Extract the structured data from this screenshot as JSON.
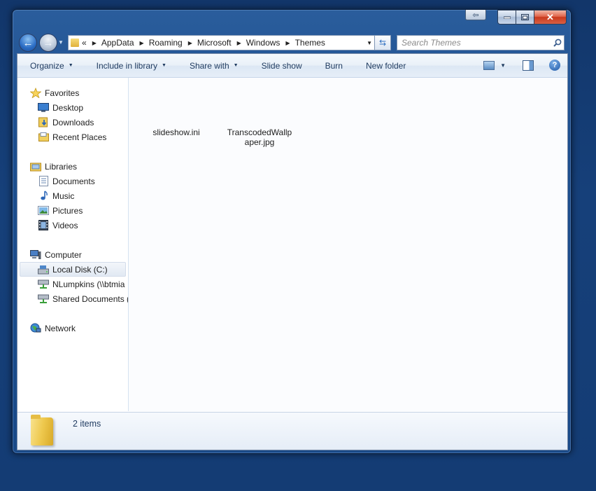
{
  "window": {
    "caption": {
      "minimize": "▁",
      "maximize": "▢",
      "close": "✕",
      "back_tab": "⇦"
    }
  },
  "nav": {
    "back_glyph": "←",
    "forward_glyph": "→",
    "address": {
      "overflow": "«",
      "crumbs": [
        "AppData",
        "Roaming",
        "Microsoft",
        "Windows",
        "Themes"
      ]
    },
    "search": {
      "placeholder": "Search Themes"
    }
  },
  "toolbar": {
    "organize": "Organize",
    "include_in_library": "Include in library",
    "share_with": "Share with",
    "slide_show": "Slide show",
    "burn": "Burn",
    "new_folder": "New folder",
    "help": "?"
  },
  "sidebar": {
    "favorites": {
      "label": "Favorites",
      "items": [
        "Desktop",
        "Downloads",
        "Recent Places"
      ]
    },
    "libraries": {
      "label": "Libraries",
      "items": [
        "Documents",
        "Music",
        "Pictures",
        "Videos"
      ]
    },
    "computer": {
      "label": "Computer",
      "items": [
        "Local Disk (C:)",
        "NLumpkins (\\\\btmia",
        "Shared Documents ("
      ]
    },
    "network": {
      "label": "Network"
    }
  },
  "files": [
    {
      "name": "slideshow.ini"
    },
    {
      "name": "TranscodedWallpaper.jpg",
      "line1": "TranscodedWallp",
      "line2": "aper.jpg"
    }
  ],
  "details": {
    "item_count": "2 items"
  },
  "colors": {
    "desktop": "#143c74",
    "window_frame": "#1d4e8e",
    "accent": "#1e3a5f"
  }
}
